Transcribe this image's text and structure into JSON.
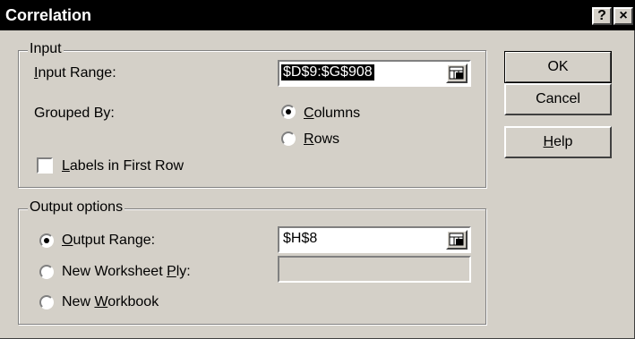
{
  "window": {
    "title": "Correlation",
    "help_symbol": "?",
    "close_symbol": "×"
  },
  "input_group": {
    "legend": "Input",
    "input_range": {
      "label_access_key": "I",
      "label_rest": "nput Range:",
      "value": "$D$9:$G$908"
    },
    "grouped_by": {
      "label": "Grouped By:",
      "options": [
        {
          "access_key": "C",
          "rest": "olumns",
          "selected": true
        },
        {
          "access_key": "R",
          "rest": "ows",
          "selected": false
        }
      ]
    },
    "labels_first_row": {
      "access_key": "L",
      "rest": "abels in First Row",
      "checked": false
    }
  },
  "output_group": {
    "legend": "Output options",
    "output_range": {
      "access_key": "O",
      "rest": "utput Range:",
      "value": "$H$8",
      "selected": true
    },
    "new_worksheet": {
      "prefix": "New Worksheet ",
      "access_key": "P",
      "rest": "ly:",
      "value": "",
      "selected": false
    },
    "new_workbook": {
      "prefix": "New ",
      "access_key": "W",
      "rest": "orkbook",
      "selected": false
    }
  },
  "buttons": {
    "ok": "OK",
    "cancel": "Cancel",
    "help": {
      "access_key": "H",
      "rest": "elp"
    }
  }
}
